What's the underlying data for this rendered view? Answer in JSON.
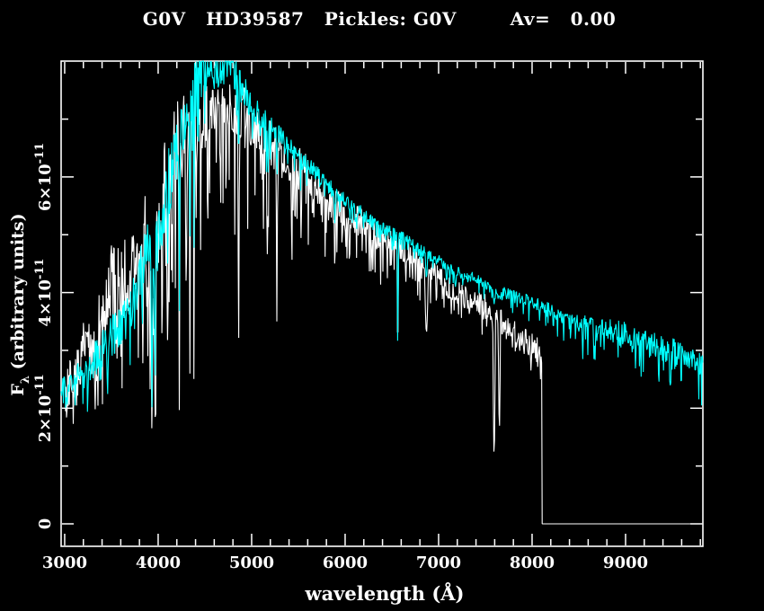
{
  "title": {
    "text": "G0V   HD39587   Pickles: G0V        Av=   0.00",
    "color": "#ffffff"
  },
  "axes": {
    "x": {
      "label": "wavelength (Å)",
      "min": 2962,
      "max": 9827,
      "major_ticks": [
        3000,
        4000,
        5000,
        6000,
        7000,
        8000,
        9000
      ],
      "minor_step": 200
    },
    "y": {
      "label_prefix": "F",
      "label_subscript": "λ",
      "label_suffix": " (arbitrary units)",
      "unit_scale": "1e-11",
      "min_flux_1e11": -0.39,
      "max_flux_1e11": 8.0,
      "ticks": [
        {
          "value": 0,
          "mantissa": "0",
          "exponent": ""
        },
        {
          "value": 2,
          "mantissa": "2×10",
          "exponent": "-11"
        },
        {
          "value": 4,
          "mantissa": "4×10",
          "exponent": "-11"
        },
        {
          "value": 6,
          "mantissa": "6×10",
          "exponent": "-11"
        }
      ],
      "minor_values": [
        1,
        3,
        5,
        7
      ]
    }
  },
  "colors": {
    "background": "#000000",
    "frame": "#ffffff",
    "observed": "#ffffff",
    "template": "#00ffff"
  },
  "chart_data": {
    "type": "line",
    "title": "G0V   HD39587   Pickles: G0V        Av=   0.00",
    "xlabel": "wavelength (Å)",
    "ylabel": "Fλ (arbitrary units)",
    "x_range": [
      2962,
      9827
    ],
    "y_range_flux_1e11": [
      -0.39,
      8.0
    ],
    "grid": false,
    "legend": "none",
    "series": [
      {
        "name": "observed-spectrum",
        "description": "HD39587 observed spectrum (white), ends at 8106 Å then zero",
        "color": "#ffffff",
        "x_start": 3008,
        "x_end": 9827,
        "step": 6,
        "seed": 3,
        "zero_from": 8106,
        "spike_prob": 0.3,
        "anchors": [
          [
            3008,
            2.1
          ],
          [
            3060,
            2.5
          ],
          [
            3110,
            2.35
          ],
          [
            3180,
            2.9
          ],
          [
            3250,
            3.15
          ],
          [
            3320,
            3.0
          ],
          [
            3400,
            3.6
          ],
          [
            3500,
            4.1
          ],
          [
            3600,
            4.3
          ],
          [
            3700,
            4.25
          ],
          [
            3760,
            4.6
          ],
          [
            3820,
            4.85
          ],
          [
            3870,
            5.0
          ],
          [
            3910,
            4.4
          ],
          [
            3960,
            3.6
          ],
          [
            4000,
            5.3
          ],
          [
            4060,
            5.75
          ],
          [
            4120,
            6.1
          ],
          [
            4180,
            6.45
          ],
          [
            4240,
            6.7
          ],
          [
            4300,
            6.7
          ],
          [
            4360,
            6.9
          ],
          [
            4420,
            6.95
          ],
          [
            4500,
            7.05
          ],
          [
            4600,
            7.15
          ],
          [
            4700,
            7.3
          ],
          [
            4780,
            7.2
          ],
          [
            4860,
            7.0
          ],
          [
            4920,
            7.15
          ],
          [
            5000,
            7.0
          ],
          [
            5100,
            6.85
          ],
          [
            5200,
            6.65
          ],
          [
            5300,
            6.5
          ],
          [
            5400,
            6.35
          ],
          [
            5500,
            6.15
          ],
          [
            5600,
            6.0
          ],
          [
            5700,
            5.85
          ],
          [
            5800,
            5.7
          ],
          [
            5900,
            5.5
          ],
          [
            6000,
            5.4
          ],
          [
            6100,
            5.3
          ],
          [
            6200,
            5.15
          ],
          [
            6300,
            5.05
          ],
          [
            6400,
            4.95
          ],
          [
            6500,
            4.9
          ],
          [
            6600,
            4.78
          ],
          [
            6700,
            4.65
          ],
          [
            6800,
            4.55
          ],
          [
            6950,
            4.35
          ],
          [
            7100,
            4.1
          ],
          [
            7250,
            3.95
          ],
          [
            7400,
            3.85
          ],
          [
            7550,
            3.75
          ],
          [
            7700,
            3.45
          ],
          [
            7850,
            3.25
          ],
          [
            8000,
            3.1
          ],
          [
            8100,
            3.0
          ]
        ],
        "noise": [
          [
            3008,
            0.4
          ],
          [
            3200,
            0.55
          ],
          [
            3400,
            0.7
          ],
          [
            3650,
            0.75
          ],
          [
            3900,
            0.8
          ],
          [
            4100,
            0.8
          ],
          [
            4300,
            0.7
          ],
          [
            4500,
            0.55
          ],
          [
            4800,
            0.45
          ],
          [
            5100,
            0.5
          ],
          [
            5400,
            0.42
          ],
          [
            5700,
            0.33
          ],
          [
            6000,
            0.28
          ],
          [
            6300,
            0.24
          ],
          [
            6600,
            0.22
          ],
          [
            7000,
            0.2
          ],
          [
            7400,
            0.2
          ],
          [
            7800,
            0.22
          ],
          [
            8100,
            0.22
          ]
        ],
        "spikes": [
          [
            3008,
            0.9
          ],
          [
            3300,
            1.4
          ],
          [
            3600,
            1.7
          ],
          [
            3900,
            2.3
          ],
          [
            4100,
            2.6
          ],
          [
            4300,
            2.4
          ],
          [
            4600,
            1.9
          ],
          [
            4900,
            1.9
          ],
          [
            5200,
            1.9
          ],
          [
            5500,
            1.5
          ],
          [
            5800,
            1.1
          ],
          [
            6100,
            0.9
          ],
          [
            6400,
            0.7
          ],
          [
            6800,
            0.55
          ],
          [
            7200,
            0.5
          ],
          [
            7600,
            0.45
          ],
          [
            8100,
            0.4
          ]
        ],
        "lines": [
          [
            3835,
            8,
            2.7
          ],
          [
            3890,
            8,
            2.9
          ],
          [
            3933,
            11,
            1.6
          ],
          [
            3968,
            9,
            1.85
          ],
          [
            4045,
            6,
            3.7
          ],
          [
            4102,
            9,
            2.9
          ],
          [
            4144,
            6,
            4.0
          ],
          [
            4227,
            7,
            1.75
          ],
          [
            4300,
            10,
            4.0
          ],
          [
            4340,
            8,
            2.6
          ],
          [
            4383,
            7,
            2.3
          ],
          [
            4455,
            6,
            4.6
          ],
          [
            4530,
            7,
            5.0
          ],
          [
            4668,
            6,
            5.2
          ],
          [
            4861,
            9,
            3.1
          ],
          [
            4958,
            6,
            5.1
          ],
          [
            5167,
            9,
            4.6
          ],
          [
            5270,
            8,
            3.5
          ],
          [
            5430,
            7,
            4.3
          ],
          [
            5530,
            6,
            4.7
          ],
          [
            5890,
            9,
            4.4
          ],
          [
            6122,
            6,
            4.6
          ],
          [
            6280,
            7,
            4.4
          ],
          [
            6563,
            9,
            3.0
          ],
          [
            6720,
            6,
            4.2
          ],
          [
            6870,
            22,
            3.3
          ],
          [
            7180,
            26,
            3.9
          ],
          [
            7330,
            8,
            3.6
          ],
          [
            7594,
            15,
            1.15
          ],
          [
            7650,
            13,
            1.6
          ],
          [
            8090,
            7,
            2.5
          ]
        ]
      },
      {
        "name": "pickles-template",
        "description": "Pickles G0V template spectrum (cyan)",
        "color": "#00ffff",
        "x_start": 2962,
        "x_end": 9827,
        "step": 6,
        "seed": 11,
        "zero_from": null,
        "spike_prob": 0.25,
        "anchors": [
          [
            2962,
            2.35
          ],
          [
            3020,
            2.25
          ],
          [
            3100,
            2.45
          ],
          [
            3200,
            2.6
          ],
          [
            3300,
            2.8
          ],
          [
            3400,
            3.0
          ],
          [
            3500,
            3.25
          ],
          [
            3600,
            3.4
          ],
          [
            3700,
            3.6
          ],
          [
            3780,
            4.1
          ],
          [
            3850,
            4.6
          ],
          [
            3900,
            4.85
          ],
          [
            3950,
            4.5
          ],
          [
            4000,
            5.1
          ],
          [
            4060,
            5.5
          ],
          [
            4120,
            6.0
          ],
          [
            4180,
            6.4
          ],
          [
            4240,
            6.75
          ],
          [
            4300,
            7.0
          ],
          [
            4360,
            7.5
          ],
          [
            4420,
            7.9
          ],
          [
            4470,
            8.1
          ],
          [
            4530,
            8.05
          ],
          [
            4580,
            7.8
          ],
          [
            4640,
            7.9
          ],
          [
            4700,
            8.1
          ],
          [
            4760,
            8.1
          ],
          [
            4820,
            7.85
          ],
          [
            4880,
            7.55
          ],
          [
            4940,
            7.4
          ],
          [
            5000,
            7.2
          ],
          [
            5100,
            7.0
          ],
          [
            5200,
            6.85
          ],
          [
            5300,
            6.7
          ],
          [
            5400,
            6.55
          ],
          [
            5500,
            6.35
          ],
          [
            5600,
            6.2
          ],
          [
            5700,
            6.05
          ],
          [
            5800,
            5.9
          ],
          [
            5900,
            5.7
          ],
          [
            6000,
            5.6
          ],
          [
            6100,
            5.45
          ],
          [
            6200,
            5.35
          ],
          [
            6300,
            5.2
          ],
          [
            6400,
            5.1
          ],
          [
            6500,
            5.05
          ],
          [
            6600,
            4.95
          ],
          [
            6700,
            4.85
          ],
          [
            6800,
            4.75
          ],
          [
            6900,
            4.65
          ],
          [
            7000,
            4.55
          ],
          [
            7100,
            4.45
          ],
          [
            7200,
            4.35
          ],
          [
            7300,
            4.3
          ],
          [
            7400,
            4.25
          ],
          [
            7500,
            4.15
          ],
          [
            7600,
            4.05
          ],
          [
            7700,
            4.0
          ],
          [
            7800,
            3.95
          ],
          [
            7900,
            3.9
          ],
          [
            8000,
            3.85
          ],
          [
            8100,
            3.75
          ],
          [
            8200,
            3.7
          ],
          [
            8300,
            3.6
          ],
          [
            8400,
            3.55
          ],
          [
            8500,
            3.5
          ],
          [
            8600,
            3.45
          ],
          [
            8700,
            3.4
          ],
          [
            8800,
            3.4
          ],
          [
            8900,
            3.35
          ],
          [
            9000,
            3.3
          ],
          [
            9100,
            3.2
          ],
          [
            9200,
            3.15
          ],
          [
            9300,
            3.1
          ],
          [
            9400,
            3.05
          ],
          [
            9500,
            3.0
          ],
          [
            9600,
            2.95
          ],
          [
            9700,
            2.85
          ],
          [
            9827,
            2.75
          ]
        ],
        "noise": [
          [
            2962,
            0.25
          ],
          [
            3300,
            0.3
          ],
          [
            3600,
            0.4
          ],
          [
            3850,
            0.5
          ],
          [
            4100,
            0.55
          ],
          [
            4400,
            0.5
          ],
          [
            4700,
            0.4
          ],
          [
            5000,
            0.28
          ],
          [
            5300,
            0.18
          ],
          [
            5600,
            0.15
          ],
          [
            6000,
            0.13
          ],
          [
            6500,
            0.12
          ],
          [
            7000,
            0.1
          ],
          [
            7500,
            0.1
          ],
          [
            8000,
            0.11
          ],
          [
            8500,
            0.13
          ],
          [
            8900,
            0.18
          ],
          [
            9300,
            0.22
          ],
          [
            9827,
            0.2
          ]
        ],
        "spikes": [
          [
            2962,
            0.5
          ],
          [
            3400,
            0.8
          ],
          [
            3700,
            1.1
          ],
          [
            4000,
            1.5
          ],
          [
            4300,
            1.5
          ],
          [
            4700,
            1.1
          ],
          [
            5100,
            0.7
          ],
          [
            5500,
            0.5
          ],
          [
            6000,
            0.4
          ],
          [
            6500,
            0.3
          ],
          [
            7000,
            0.25
          ],
          [
            7500,
            0.3
          ],
          [
            8000,
            0.35
          ],
          [
            8500,
            0.5
          ],
          [
            9000,
            0.6
          ],
          [
            9400,
            0.7
          ],
          [
            9827,
            0.6
          ]
        ],
        "lines": [
          [
            3830,
            7,
            3.3
          ],
          [
            3933,
            10,
            1.95
          ],
          [
            3968,
            8,
            2.3
          ],
          [
            4102,
            8,
            4.5
          ],
          [
            4227,
            6,
            3.5
          ],
          [
            4340,
            7,
            4.6
          ],
          [
            4383,
            6,
            4.6
          ],
          [
            4861,
            8,
            6.3
          ],
          [
            5175,
            8,
            6.05
          ],
          [
            5270,
            6,
            5.9
          ],
          [
            5890,
            8,
            5.2
          ],
          [
            6122,
            5,
            5.0
          ],
          [
            6563,
            8,
            3.1
          ],
          [
            6870,
            14,
            4.25
          ],
          [
            7180,
            14,
            4.1
          ],
          [
            7594,
            11,
            3.8
          ],
          [
            7680,
            8,
            3.85
          ],
          [
            8227,
            7,
            3.35
          ],
          [
            8498,
            7,
            3.3
          ],
          [
            8542,
            8,
            2.85
          ],
          [
            8662,
            8,
            2.85
          ],
          [
            8950,
            8,
            3.05
          ],
          [
            9080,
            8,
            3.0
          ],
          [
            9150,
            8,
            2.95
          ],
          [
            9356,
            9,
            2.4
          ],
          [
            9430,
            7,
            2.8
          ],
          [
            9550,
            8,
            2.75
          ],
          [
            9780,
            8,
            2.6
          ]
        ]
      }
    ]
  }
}
